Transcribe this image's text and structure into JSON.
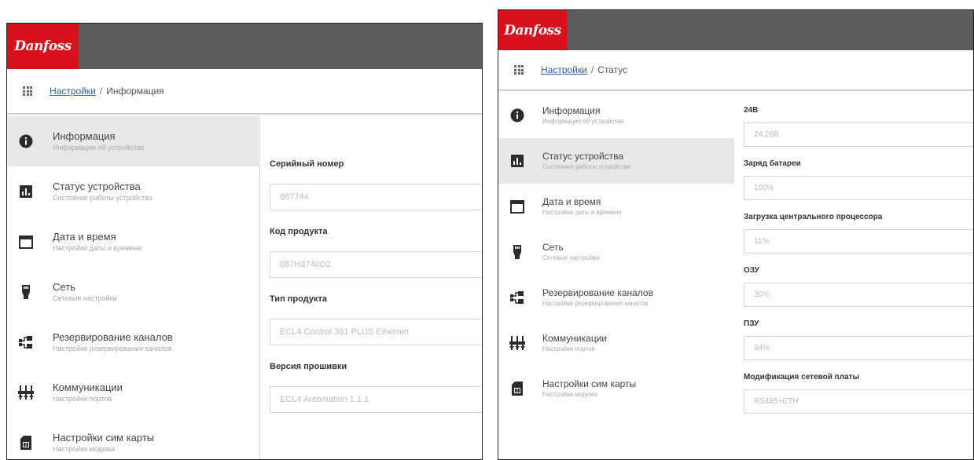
{
  "brand": {
    "logo_text": "Danfoss",
    "color": "#d8121c",
    "topbar_color": "#5c5c5c",
    "link_color": "#2c5fa8"
  },
  "left": {
    "breadcrumb": {
      "link": "Настройки",
      "separator": "/",
      "current": "Информация"
    },
    "nav": [
      {
        "title": "Информация",
        "subtitle": "Информация об устройстве",
        "icon": "info-icon",
        "active": true
      },
      {
        "title": "Статус устройства",
        "subtitle": "Состояние работы устройства",
        "icon": "chart-icon",
        "active": false
      },
      {
        "title": "Дата и время",
        "subtitle": "Настройки даты и времени",
        "icon": "calendar-icon",
        "active": false
      },
      {
        "title": "Сеть",
        "subtitle": "Сетевые настройки",
        "icon": "network-icon",
        "active": false
      },
      {
        "title": "Резервирование каналов",
        "subtitle": "Настройки резервирования каналов",
        "icon": "channels-icon",
        "active": false
      },
      {
        "title": "Коммуникации",
        "subtitle": "Настройки портов",
        "icon": "ports-icon",
        "active": false
      },
      {
        "title": "Настройки сим карты",
        "subtitle": "Настройки модема",
        "icon": "sim-icon",
        "active": false
      }
    ],
    "fields": [
      {
        "label": "Серийный номер",
        "value": "887744"
      },
      {
        "label": "Код продукта",
        "value": "087H3740D2"
      },
      {
        "label": "Тип продукта",
        "value": "ECL4 Control 361 PLUS Ethernet"
      },
      {
        "label": "Версия прошивки",
        "value": "ECL4 Automation 1.1.1"
      }
    ]
  },
  "right": {
    "breadcrumb": {
      "link": "Настройки",
      "separator": "/",
      "current": "Статус"
    },
    "nav": [
      {
        "title": "Информация",
        "subtitle": "Информация об устройстве",
        "icon": "info-icon",
        "active": false
      },
      {
        "title": "Статус устройства",
        "subtitle": "Состояние работы устройства",
        "icon": "chart-icon",
        "active": true
      },
      {
        "title": "Дата и время",
        "subtitle": "Настройки даты и времени",
        "icon": "calendar-icon",
        "active": false
      },
      {
        "title": "Сеть",
        "subtitle": "Сетевые настройки",
        "icon": "network-icon",
        "active": false
      },
      {
        "title": "Резервирование каналов",
        "subtitle": "Настройки резервирования каналов",
        "icon": "channels-icon",
        "active": false
      },
      {
        "title": "Коммуникации",
        "subtitle": "Настройки портов",
        "icon": "ports-icon",
        "active": false
      },
      {
        "title": "Настройки сим карты",
        "subtitle": "Настройки модема",
        "icon": "sim-icon",
        "active": false
      }
    ],
    "fields": [
      {
        "label": "24В",
        "value": "24.26В"
      },
      {
        "label": "Заряд батареи",
        "value": "100%"
      },
      {
        "label": "Загрузка центрального процессора",
        "value": "11%"
      },
      {
        "label": "ОЗУ",
        "value": "30%"
      },
      {
        "label": "ПЗУ",
        "value": "34%"
      },
      {
        "label": "Модификация сетевой платы",
        "value": "RS485+ETH"
      }
    ]
  }
}
